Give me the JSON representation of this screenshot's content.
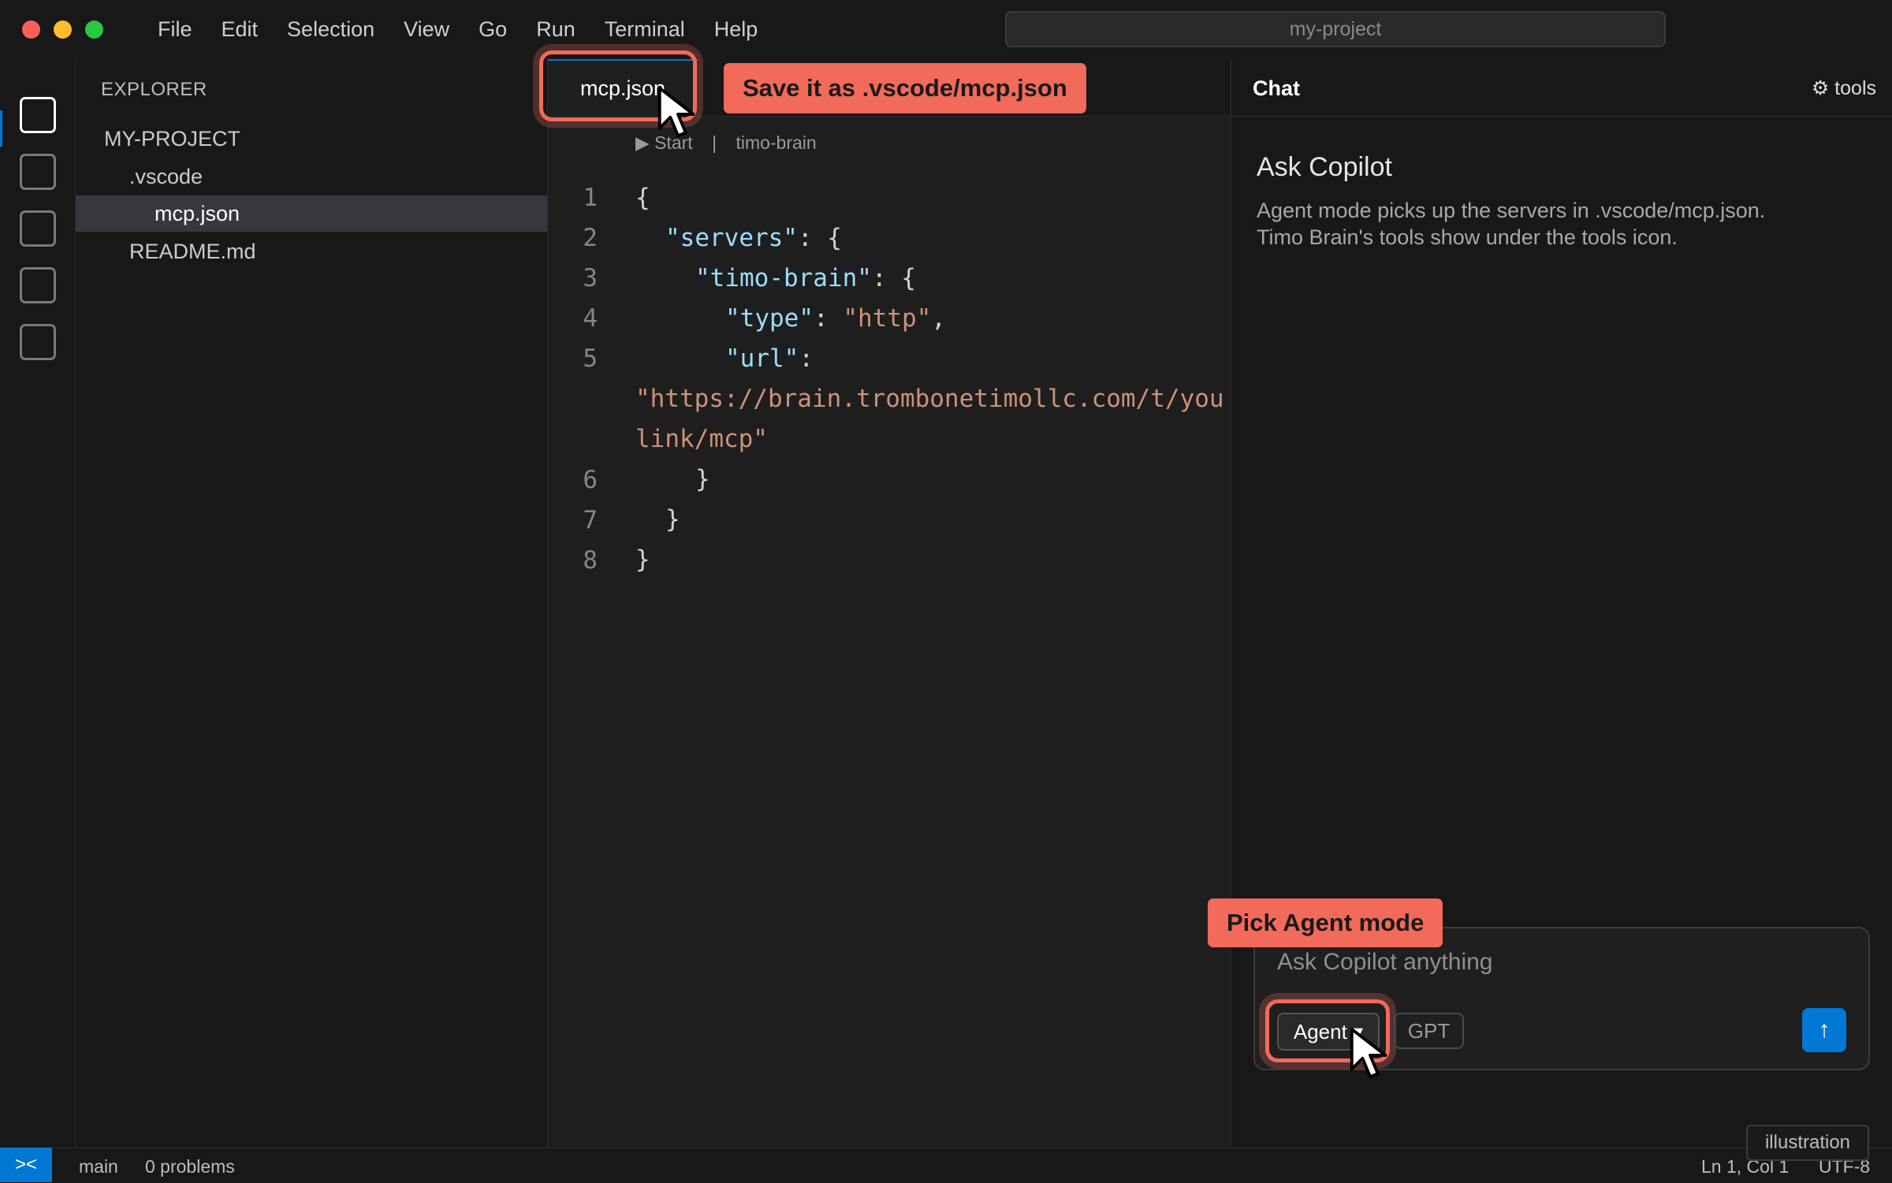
{
  "window": {
    "search_title": "my-project",
    "traffic_light_colors": [
      "#ff5f57",
      "#febc2e",
      "#28c840"
    ]
  },
  "menu": [
    "File",
    "Edit",
    "Selection",
    "View",
    "Go",
    "Run",
    "Terminal",
    "Help"
  ],
  "activity_bar": {
    "items": [
      "explorer-icon",
      "search-icon",
      "source-control-icon",
      "run-debug-icon",
      "extensions-icon"
    ]
  },
  "explorer": {
    "header": "EXPLORER",
    "items": [
      {
        "label": "MY-PROJECT",
        "depth": 0,
        "selected": false
      },
      {
        "label": ".vscode",
        "depth": 1,
        "selected": false
      },
      {
        "label": "mcp.json",
        "depth": 2,
        "selected": true
      },
      {
        "label": "README.md",
        "depth": 1,
        "selected": false
      }
    ]
  },
  "editor": {
    "tab_label": "mcp.json",
    "callout_save": "Save it as .vscode/mcp.json",
    "codelens": {
      "start": "Start",
      "separator": "|",
      "server": "timo-brain"
    },
    "line_numbers": [
      "1",
      "2",
      "3",
      "4",
      "5",
      "6",
      "7",
      "8"
    ],
    "code": {
      "l1": "{",
      "l2_key": "\"servers\"",
      "l2_rest": ": {",
      "l3_key": "\"timo-brain\"",
      "l3_rest": ": {",
      "l4_key": "\"type\"",
      "l4_colon": ": ",
      "l4_val": "\"http\"",
      "l4_end": ",",
      "l5_key": "\"url\"",
      "l5_rest": ":",
      "l5_val_a": "\"https://brain.trombonetimollc.com/t/you",
      "l5_val_b": "link/mcp\"",
      "l6": "}",
      "l7": "}",
      "l8": "}"
    }
  },
  "chat": {
    "title": "Chat",
    "tools_label": "⚙ tools",
    "heading": "Ask Copilot",
    "body_line1": "Agent mode picks up the servers in .vscode/mcp.json.",
    "body_line2": "Timo Brain's tools show under the tools icon.",
    "callout_agent": "Pick Agent mode",
    "input_placeholder": "Ask Copilot anything",
    "agent_label": "Agent ▾",
    "gpt_label": "GPT",
    "send_label": "↑"
  },
  "statusbar": {
    "remote_glyph": "><",
    "branch": "main",
    "problems": "0 problems",
    "position": "Ln 1, Col 1",
    "encoding": "UTF-8",
    "illustration_badge": "illustration"
  },
  "colors": {
    "accent": "#0078d4",
    "callout": "#f26a5a",
    "json_key": "#9cdcfe",
    "json_string": "#ce9178"
  }
}
